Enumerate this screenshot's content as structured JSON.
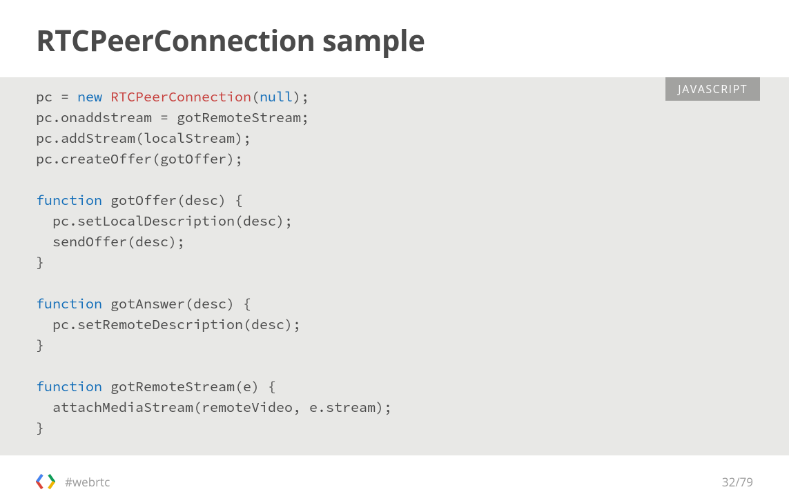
{
  "header": {
    "title": "RTCPeerConnection sample"
  },
  "codeBlock": {
    "langBadge": "JAVASCRIPT",
    "tokens": [
      {
        "t": "pc = ",
        "c": ""
      },
      {
        "t": "new",
        "c": "k-blue"
      },
      {
        "t": " ",
        "c": ""
      },
      {
        "t": "RTCPeerConnection",
        "c": "k-red"
      },
      {
        "t": "(",
        "c": ""
      },
      {
        "t": "null",
        "c": "k-blue"
      },
      {
        "t": ");\npc.onaddstream = gotRemoteStream;\npc.addStream(localStream);\npc.createOffer(gotOffer);\n\n",
        "c": ""
      },
      {
        "t": "function",
        "c": "k-blue"
      },
      {
        "t": " gotOffer(desc) {\n  pc.setLocalDescription(desc);\n  sendOffer(desc);\n}\n\n",
        "c": ""
      },
      {
        "t": "function",
        "c": "k-blue"
      },
      {
        "t": " gotAnswer(desc) {\n  pc.setRemoteDescription(desc);\n}\n\n",
        "c": ""
      },
      {
        "t": "function",
        "c": "k-blue"
      },
      {
        "t": " gotRemoteStream(e) {\n  attachMediaStream(remoteVideo, e.stream);\n}",
        "c": ""
      }
    ]
  },
  "footer": {
    "hashtag": "#webrtc",
    "pageNumber": "32/79"
  }
}
